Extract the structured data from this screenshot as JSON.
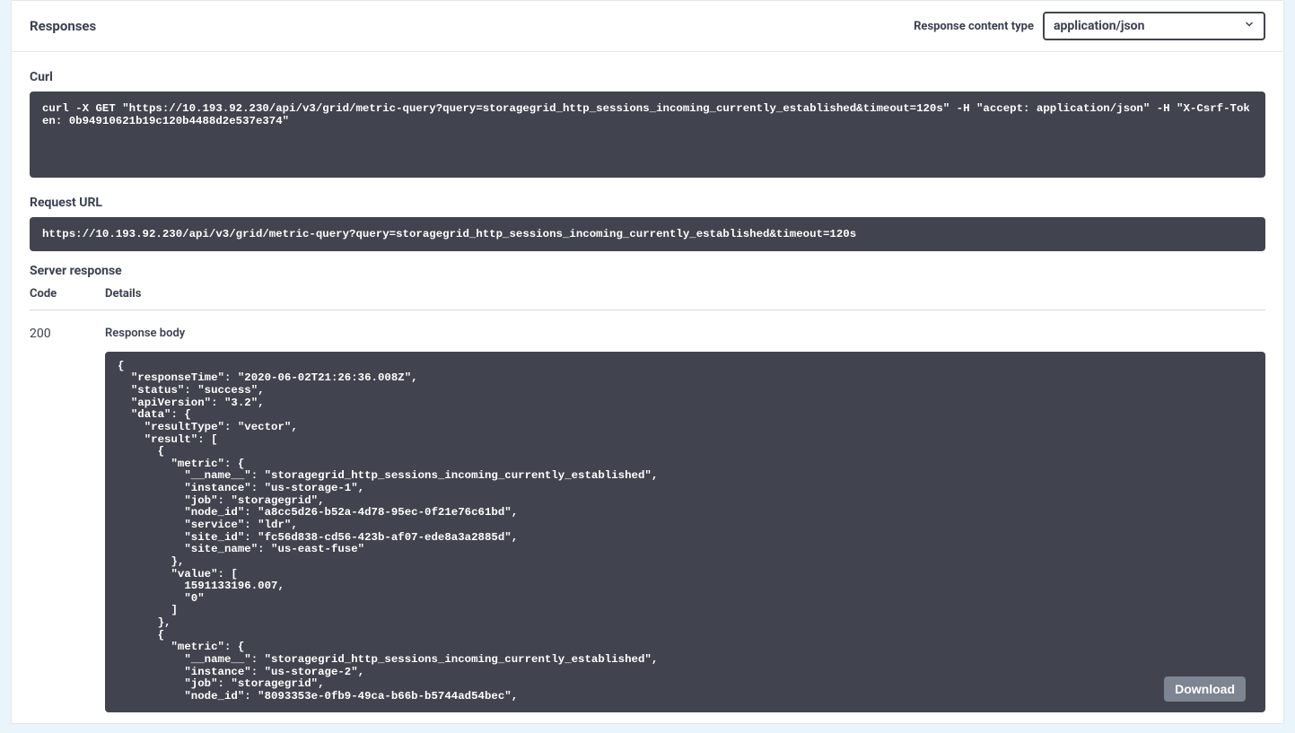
{
  "header": {
    "title": "Responses",
    "contentTypeLabel": "Response content type",
    "contentTypeValue": "application/json"
  },
  "curl": {
    "label": "Curl",
    "command": "curl -X GET \"https://10.193.92.230/api/v3/grid/metric-query?query=storagegrid_http_sessions_incoming_currently_established&timeout=120s\" -H \"accept: application/json\" -H \"X-Csrf-Token: 0b94910621b19c120b4488d2e537e374\""
  },
  "requestUrl": {
    "label": "Request URL",
    "value": "https://10.193.92.230/api/v3/grid/metric-query?query=storagegrid_http_sessions_incoming_currently_established&timeout=120s"
  },
  "serverResponse": {
    "label": "Server response",
    "columns": {
      "code": "Code",
      "details": "Details"
    },
    "code": "200",
    "bodyLabel": "Response body",
    "downloadLabel": "Download",
    "body": "{\n  \"responseTime\": \"2020-06-02T21:26:36.008Z\",\n  \"status\": \"success\",\n  \"apiVersion\": \"3.2\",\n  \"data\": {\n    \"resultType\": \"vector\",\n    \"result\": [\n      {\n        \"metric\": {\n          \"__name__\": \"storagegrid_http_sessions_incoming_currently_established\",\n          \"instance\": \"us-storage-1\",\n          \"job\": \"storagegrid\",\n          \"node_id\": \"a8cc5d26-b52a-4d78-95ec-0f21e76c61bd\",\n          \"service\": \"ldr\",\n          \"site_id\": \"fc56d838-cd56-423b-af07-ede8a3a2885d\",\n          \"site_name\": \"us-east-fuse\"\n        },\n        \"value\": [\n          1591133196.007,\n          \"0\"\n        ]\n      },\n      {\n        \"metric\": {\n          \"__name__\": \"storagegrid_http_sessions_incoming_currently_established\",\n          \"instance\": \"us-storage-2\",\n          \"job\": \"storagegrid\",\n          \"node_id\": \"8093353e-0fb9-49ca-b66b-b5744ad54bec\","
  }
}
